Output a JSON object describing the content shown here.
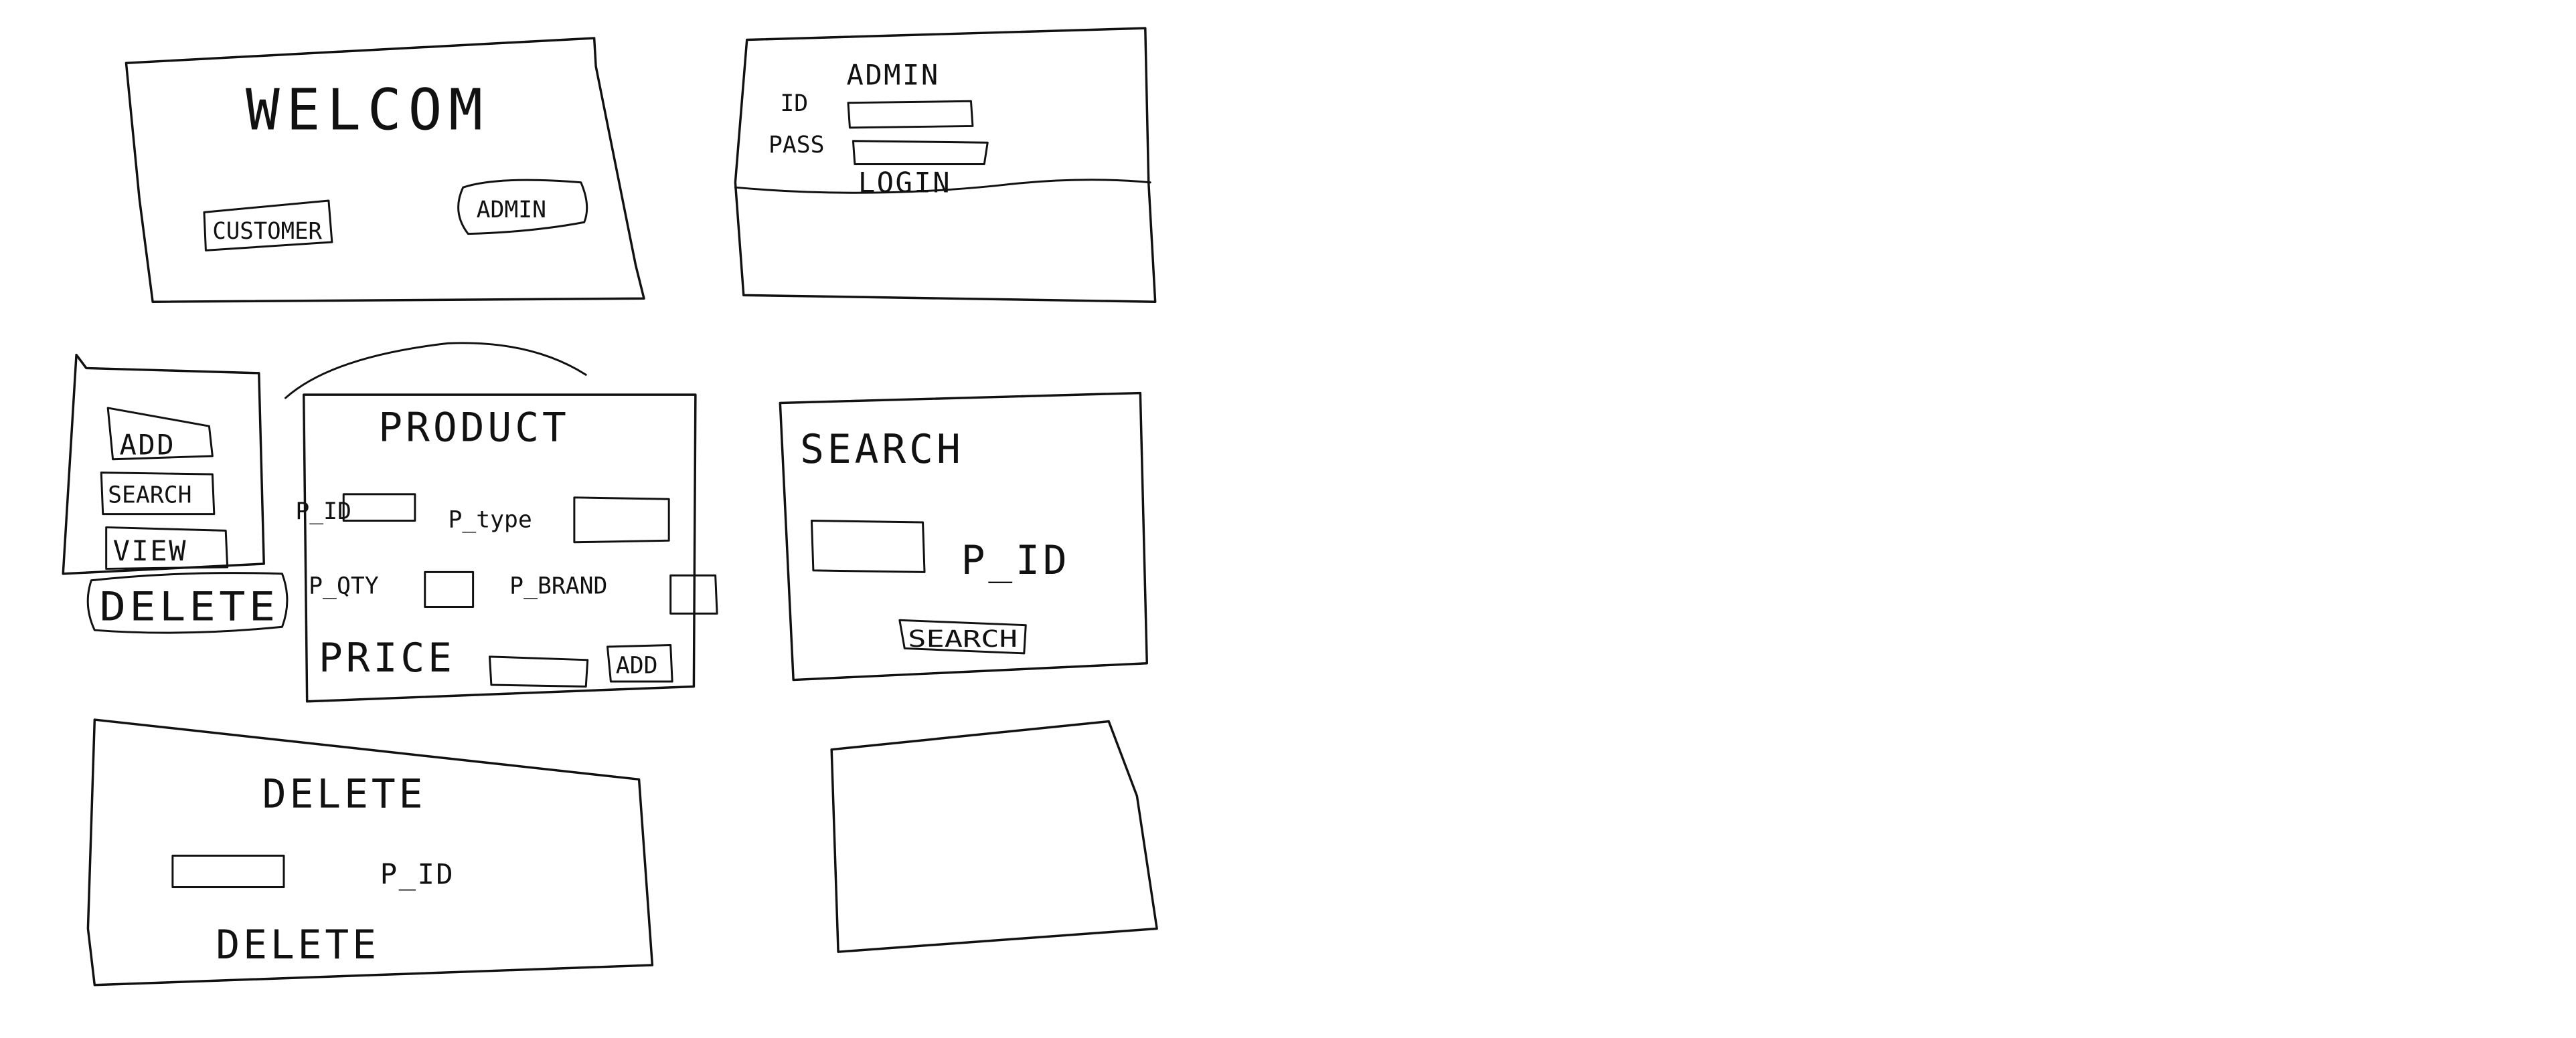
{
  "welcome_screen": {
    "title": "WELCOM",
    "user_button": "CUSTOMER",
    "admin_button": "ADMIN"
  },
  "admin_login": {
    "title": "ADMIN",
    "id_label": "ID",
    "pass_label": "PASS",
    "login_button": "LOGIN"
  },
  "menu": {
    "add_button": "ADD",
    "search_button": "SEARCH",
    "view_button": "VIEW",
    "delete_button": "DELETE"
  },
  "product_form": {
    "title": "PRODUCT",
    "id_label": "P_ID",
    "type_label": "P_type",
    "qty_label": "P_QTY",
    "brand_label": "P_BRAND",
    "price_label": "PRICE",
    "add_button": "ADD"
  },
  "search_screen": {
    "title": "SEARCH",
    "pid_label": "P_ID",
    "search_button": "SEARCH"
  },
  "delete_screen": {
    "title": "DELETE",
    "pid_label": "P_ID",
    "delete_button": "DELETE"
  }
}
